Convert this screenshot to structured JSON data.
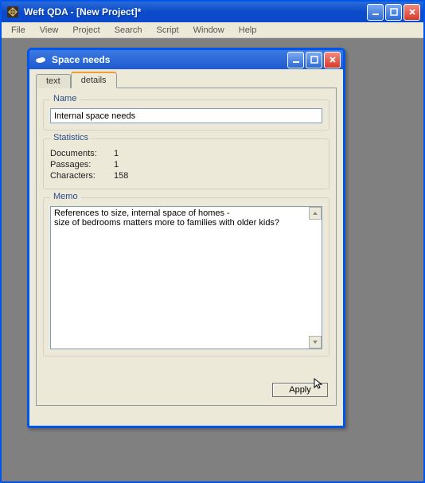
{
  "main_window": {
    "title": "Weft QDA - [New Project]*"
  },
  "menubar": {
    "items": [
      "File",
      "View",
      "Project",
      "Search",
      "Script",
      "Window",
      "Help"
    ]
  },
  "child_window": {
    "title": "Space needs"
  },
  "tabs": {
    "text": "text",
    "details": "details"
  },
  "groups": {
    "name_legend": "Name",
    "stats_legend": "Statistics",
    "memo_legend": "Memo"
  },
  "name_field": {
    "value": "Internal space needs"
  },
  "stats": {
    "documents_label": "Documents:",
    "documents_value": "1",
    "passages_label": "Passages:",
    "passages_value": "1",
    "characters_label": "Characters:",
    "characters_value": "158"
  },
  "memo": {
    "value": "References to size, internal space of homes - \nsize of bedrooms matters more to families with older kids?"
  },
  "buttons": {
    "apply": "Apply"
  }
}
